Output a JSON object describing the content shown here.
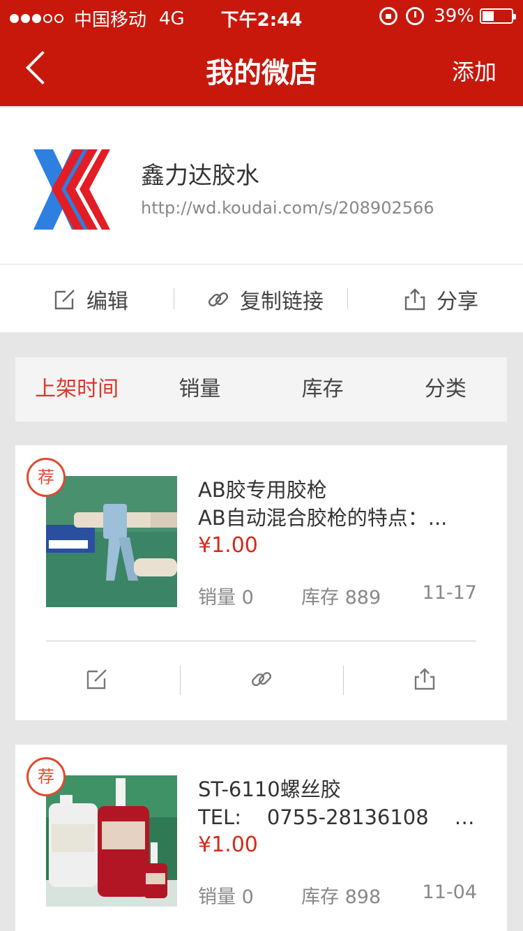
{
  "status_bar": {
    "carrier": "中国移动",
    "network": "4G",
    "time": "下午2:44",
    "battery_percent": "39%",
    "battery_level": 0.39,
    "signal_bars_on": 3,
    "signal_bars_total": 5
  },
  "nav": {
    "title": "我的微店",
    "add_label": "添加"
  },
  "shop": {
    "name": "鑫力达胶水",
    "url": "http://wd.koudai.com/s/208902566"
  },
  "actions": {
    "edit_label": "编辑",
    "copy_link_label": "复制链接",
    "share_label": "分享"
  },
  "tabs": [
    "上架时间",
    "销量",
    "库存",
    "分类"
  ],
  "products": [
    {
      "badge": "荐",
      "title": "AB胶专用胶枪",
      "description": "AB自动混合胶枪的特点：...",
      "price": "¥1.00",
      "sales": "销量 0",
      "stock": "库存 889",
      "date": "11-17"
    },
    {
      "badge": "荐",
      "title": "ST-6110螺丝胶",
      "description": "TEL:    0755-28136108    8...",
      "price": "¥1.00",
      "sales": "销量 0",
      "stock": "库存 898",
      "date": "11-04"
    }
  ],
  "colors": {
    "brand_red": "#c8170b",
    "price_red": "#d42a1a",
    "active_tab": "#d9382a"
  }
}
